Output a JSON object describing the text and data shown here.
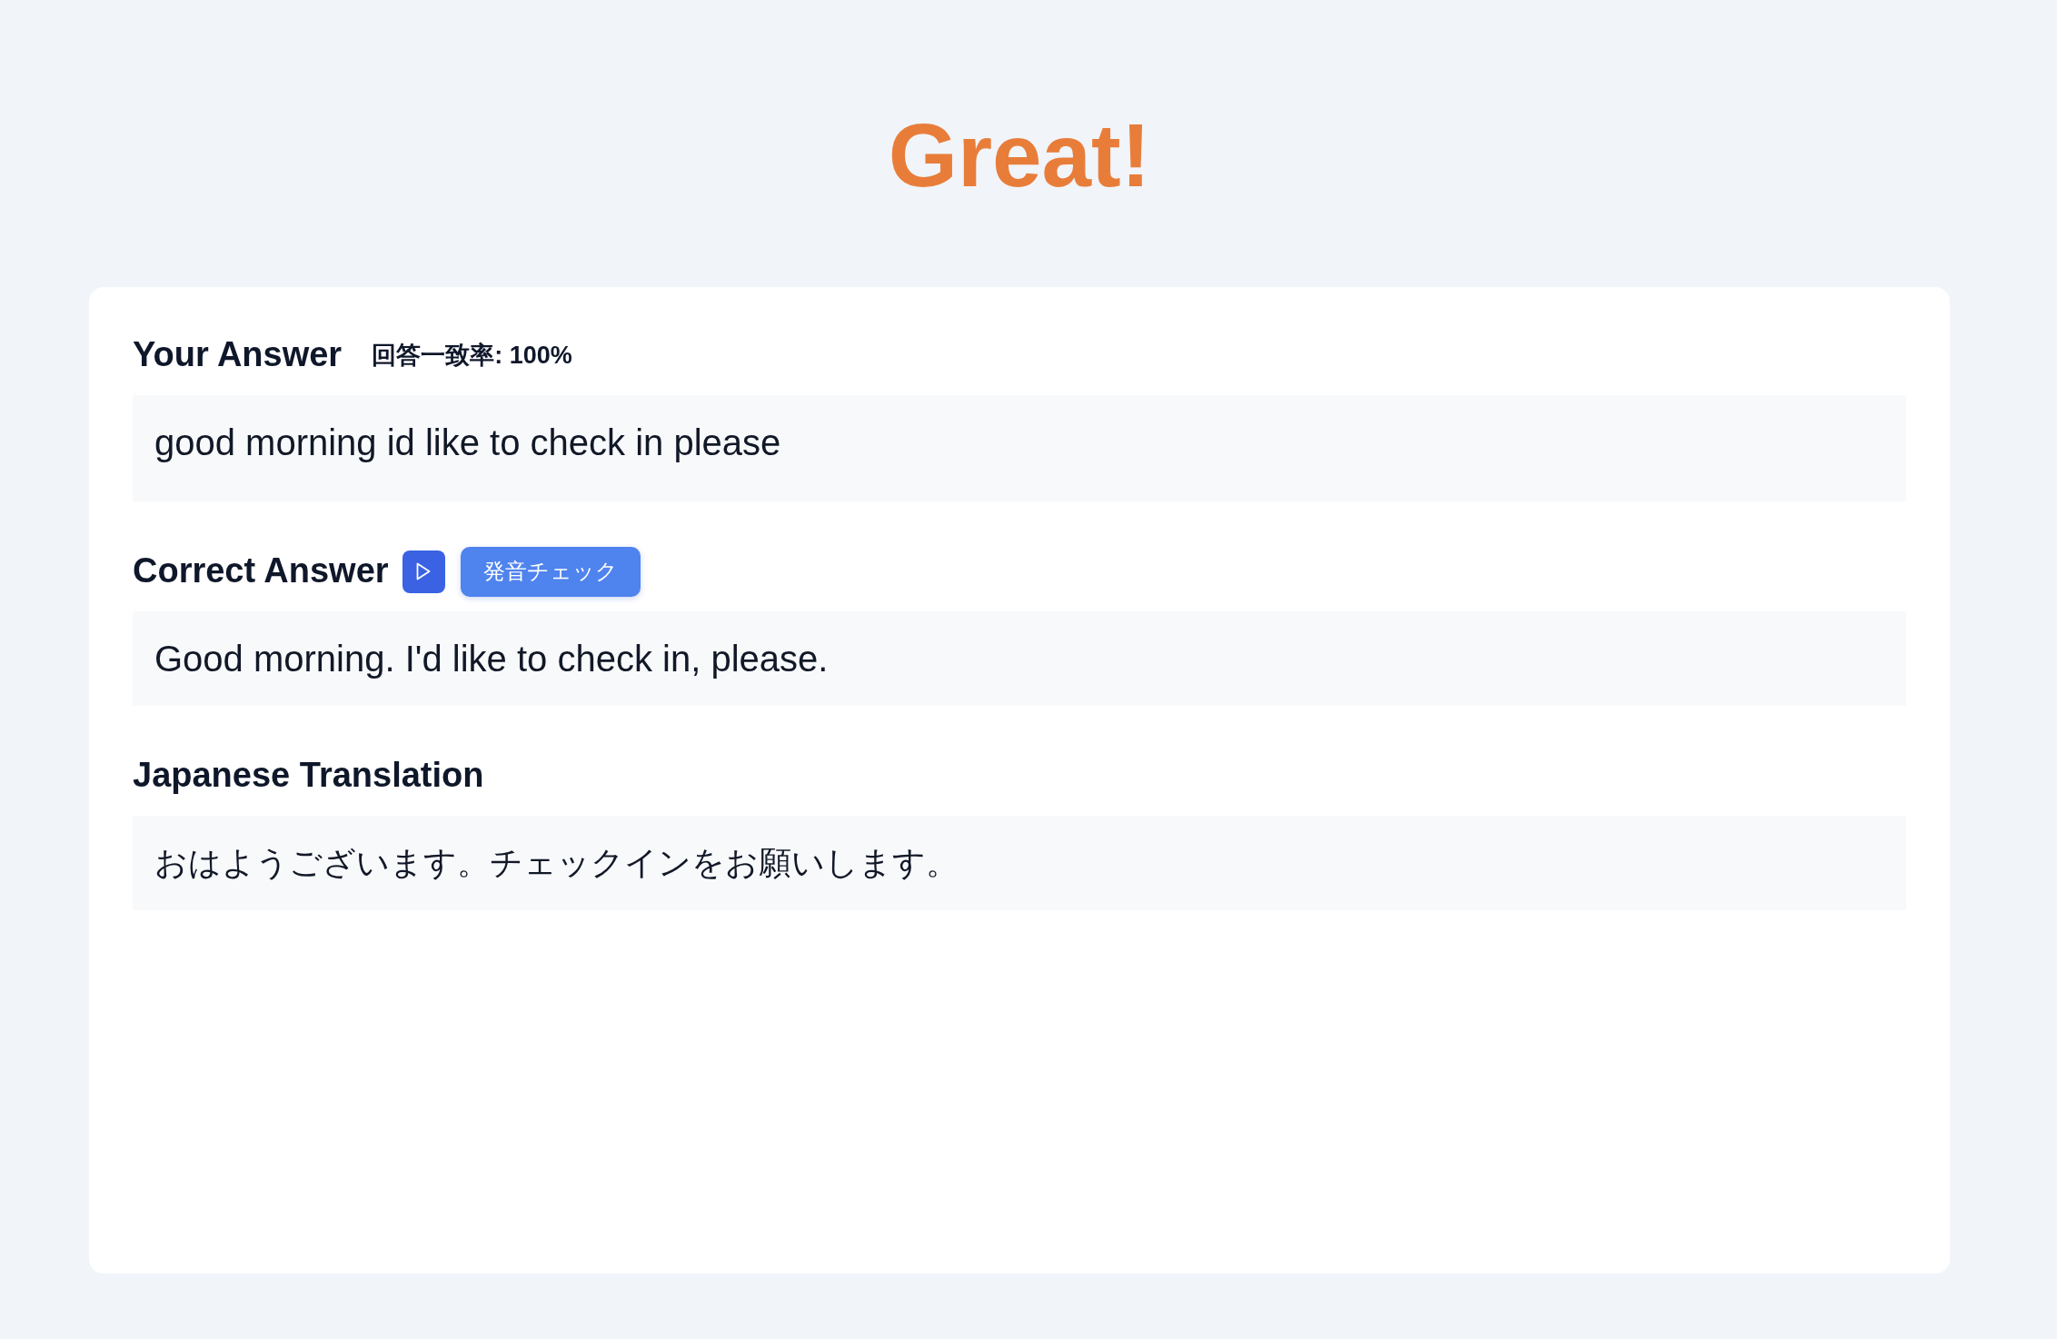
{
  "title": "Great!",
  "your_answer": {
    "heading": "Your Answer",
    "match_rate": "回答一致率: 100%",
    "text": "good morning id like to check in please"
  },
  "correct_answer": {
    "heading": "Correct Answer",
    "pronunciation_button": "発音チェック",
    "text": "Good morning. I'd like to check in, please."
  },
  "japanese_translation": {
    "heading": "Japanese Translation",
    "text": "おはようございます。チェックインをお願いします。"
  }
}
